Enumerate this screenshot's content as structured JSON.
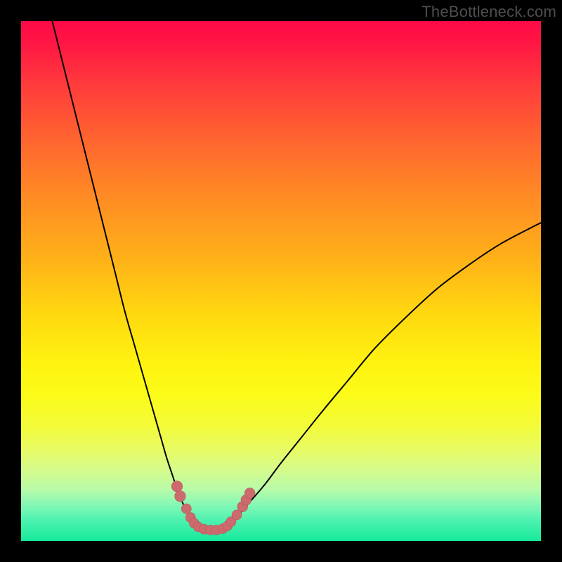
{
  "watermark": {
    "text": "TheBottleneck.com"
  },
  "colors": {
    "curve": "#000000",
    "marker_fill": "#cc6a6d",
    "marker_stroke": "#b85a5d"
  },
  "chart_data": {
    "type": "line",
    "title": "",
    "xlabel": "",
    "ylabel": "",
    "xlim": [
      0,
      100
    ],
    "ylim": [
      0,
      100
    ],
    "grid": false,
    "series": [
      {
        "name": "left-branch",
        "x": [
          6,
          8,
          10,
          12,
          14,
          16,
          18,
          20,
          22,
          24,
          26,
          27,
          28,
          29,
          30,
          31,
          32,
          33,
          34,
          35
        ],
        "y": [
          100,
          92,
          84,
          76,
          68,
          60,
          52,
          44,
          37,
          30,
          23,
          19.5,
          16,
          13,
          10,
          7.5,
          5.5,
          4,
          3,
          2.3
        ]
      },
      {
        "name": "flat-bottom",
        "x": [
          35,
          36,
          37,
          38,
          39
        ],
        "y": [
          2.3,
          2.1,
          2.0,
          2.1,
          2.4
        ]
      },
      {
        "name": "right-branch",
        "x": [
          39,
          40,
          42,
          44,
          47,
          50,
          54,
          58,
          63,
          68,
          74,
          80,
          86,
          92,
          98,
          100
        ],
        "y": [
          2.4,
          3.2,
          5.2,
          7.5,
          11,
          15,
          20,
          25,
          31,
          37,
          43,
          48.5,
          53,
          57,
          60.2,
          61.2
        ]
      }
    ],
    "markers": [
      {
        "x": 30.0,
        "y": 10.5,
        "r": 1.05
      },
      {
        "x": 30.6,
        "y": 8.6,
        "r": 1.05
      },
      {
        "x": 31.8,
        "y": 6.2,
        "r": 0.95
      },
      {
        "x": 32.6,
        "y": 4.5,
        "r": 0.95
      },
      {
        "x": 33.3,
        "y": 3.4,
        "r": 0.95
      },
      {
        "x": 34.1,
        "y": 2.7,
        "r": 0.95
      },
      {
        "x": 35.2,
        "y": 2.25,
        "r": 0.95
      },
      {
        "x": 36.4,
        "y": 2.1,
        "r": 0.95
      },
      {
        "x": 37.6,
        "y": 2.1,
        "r": 0.95
      },
      {
        "x": 38.8,
        "y": 2.35,
        "r": 0.95
      },
      {
        "x": 39.7,
        "y": 2.9,
        "r": 0.95
      },
      {
        "x": 40.4,
        "y": 3.7,
        "r": 0.95
      },
      {
        "x": 41.5,
        "y": 5.0,
        "r": 0.95
      },
      {
        "x": 42.6,
        "y": 6.6,
        "r": 1.0
      },
      {
        "x": 43.3,
        "y": 7.9,
        "r": 1.0
      },
      {
        "x": 44.0,
        "y": 9.2,
        "r": 1.0
      }
    ]
  }
}
